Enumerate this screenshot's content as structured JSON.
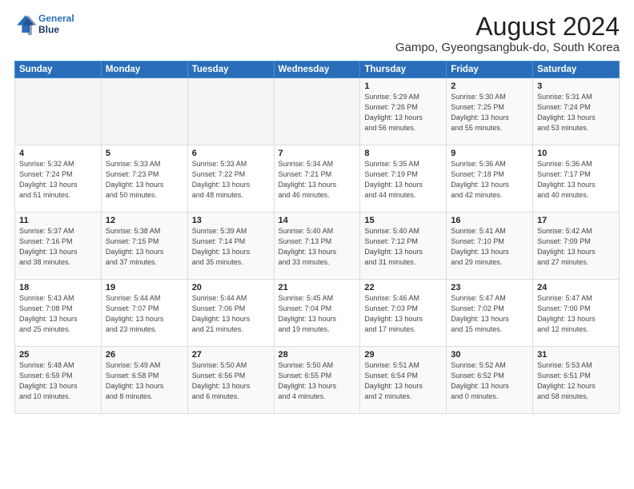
{
  "logo": {
    "line1": "General",
    "line2": "Blue"
  },
  "title": "August 2024",
  "subtitle": "Gampo, Gyeongsangbuk-do, South Korea",
  "headers": [
    "Sunday",
    "Monday",
    "Tuesday",
    "Wednesday",
    "Thursday",
    "Friday",
    "Saturday"
  ],
  "weeks": [
    [
      {
        "day": "",
        "info": ""
      },
      {
        "day": "",
        "info": ""
      },
      {
        "day": "",
        "info": ""
      },
      {
        "day": "",
        "info": ""
      },
      {
        "day": "1",
        "info": "Sunrise: 5:29 AM\nSunset: 7:26 PM\nDaylight: 13 hours\nand 56 minutes."
      },
      {
        "day": "2",
        "info": "Sunrise: 5:30 AM\nSunset: 7:25 PM\nDaylight: 13 hours\nand 55 minutes."
      },
      {
        "day": "3",
        "info": "Sunrise: 5:31 AM\nSunset: 7:24 PM\nDaylight: 13 hours\nand 53 minutes."
      }
    ],
    [
      {
        "day": "4",
        "info": "Sunrise: 5:32 AM\nSunset: 7:24 PM\nDaylight: 13 hours\nand 51 minutes."
      },
      {
        "day": "5",
        "info": "Sunrise: 5:33 AM\nSunset: 7:23 PM\nDaylight: 13 hours\nand 50 minutes."
      },
      {
        "day": "6",
        "info": "Sunrise: 5:33 AM\nSunset: 7:22 PM\nDaylight: 13 hours\nand 48 minutes."
      },
      {
        "day": "7",
        "info": "Sunrise: 5:34 AM\nSunset: 7:21 PM\nDaylight: 13 hours\nand 46 minutes."
      },
      {
        "day": "8",
        "info": "Sunrise: 5:35 AM\nSunset: 7:19 PM\nDaylight: 13 hours\nand 44 minutes."
      },
      {
        "day": "9",
        "info": "Sunrise: 5:36 AM\nSunset: 7:18 PM\nDaylight: 13 hours\nand 42 minutes."
      },
      {
        "day": "10",
        "info": "Sunrise: 5:36 AM\nSunset: 7:17 PM\nDaylight: 13 hours\nand 40 minutes."
      }
    ],
    [
      {
        "day": "11",
        "info": "Sunrise: 5:37 AM\nSunset: 7:16 PM\nDaylight: 13 hours\nand 38 minutes."
      },
      {
        "day": "12",
        "info": "Sunrise: 5:38 AM\nSunset: 7:15 PM\nDaylight: 13 hours\nand 37 minutes."
      },
      {
        "day": "13",
        "info": "Sunrise: 5:39 AM\nSunset: 7:14 PM\nDaylight: 13 hours\nand 35 minutes."
      },
      {
        "day": "14",
        "info": "Sunrise: 5:40 AM\nSunset: 7:13 PM\nDaylight: 13 hours\nand 33 minutes."
      },
      {
        "day": "15",
        "info": "Sunrise: 5:40 AM\nSunset: 7:12 PM\nDaylight: 13 hours\nand 31 minutes."
      },
      {
        "day": "16",
        "info": "Sunrise: 5:41 AM\nSunset: 7:10 PM\nDaylight: 13 hours\nand 29 minutes."
      },
      {
        "day": "17",
        "info": "Sunrise: 5:42 AM\nSunset: 7:09 PM\nDaylight: 13 hours\nand 27 minutes."
      }
    ],
    [
      {
        "day": "18",
        "info": "Sunrise: 5:43 AM\nSunset: 7:08 PM\nDaylight: 13 hours\nand 25 minutes."
      },
      {
        "day": "19",
        "info": "Sunrise: 5:44 AM\nSunset: 7:07 PM\nDaylight: 13 hours\nand 23 minutes."
      },
      {
        "day": "20",
        "info": "Sunrise: 5:44 AM\nSunset: 7:06 PM\nDaylight: 13 hours\nand 21 minutes."
      },
      {
        "day": "21",
        "info": "Sunrise: 5:45 AM\nSunset: 7:04 PM\nDaylight: 13 hours\nand 19 minutes."
      },
      {
        "day": "22",
        "info": "Sunrise: 5:46 AM\nSunset: 7:03 PM\nDaylight: 13 hours\nand 17 minutes."
      },
      {
        "day": "23",
        "info": "Sunrise: 5:47 AM\nSunset: 7:02 PM\nDaylight: 13 hours\nand 15 minutes."
      },
      {
        "day": "24",
        "info": "Sunrise: 5:47 AM\nSunset: 7:00 PM\nDaylight: 13 hours\nand 12 minutes."
      }
    ],
    [
      {
        "day": "25",
        "info": "Sunrise: 5:48 AM\nSunset: 6:59 PM\nDaylight: 13 hours\nand 10 minutes."
      },
      {
        "day": "26",
        "info": "Sunrise: 5:49 AM\nSunset: 6:58 PM\nDaylight: 13 hours\nand 8 minutes."
      },
      {
        "day": "27",
        "info": "Sunrise: 5:50 AM\nSunset: 6:56 PM\nDaylight: 13 hours\nand 6 minutes."
      },
      {
        "day": "28",
        "info": "Sunrise: 5:50 AM\nSunset: 6:55 PM\nDaylight: 13 hours\nand 4 minutes."
      },
      {
        "day": "29",
        "info": "Sunrise: 5:51 AM\nSunset: 6:54 PM\nDaylight: 13 hours\nand 2 minutes."
      },
      {
        "day": "30",
        "info": "Sunrise: 5:52 AM\nSunset: 6:52 PM\nDaylight: 13 hours\nand 0 minutes."
      },
      {
        "day": "31",
        "info": "Sunrise: 5:53 AM\nSunset: 6:51 PM\nDaylight: 12 hours\nand 58 minutes."
      }
    ]
  ]
}
